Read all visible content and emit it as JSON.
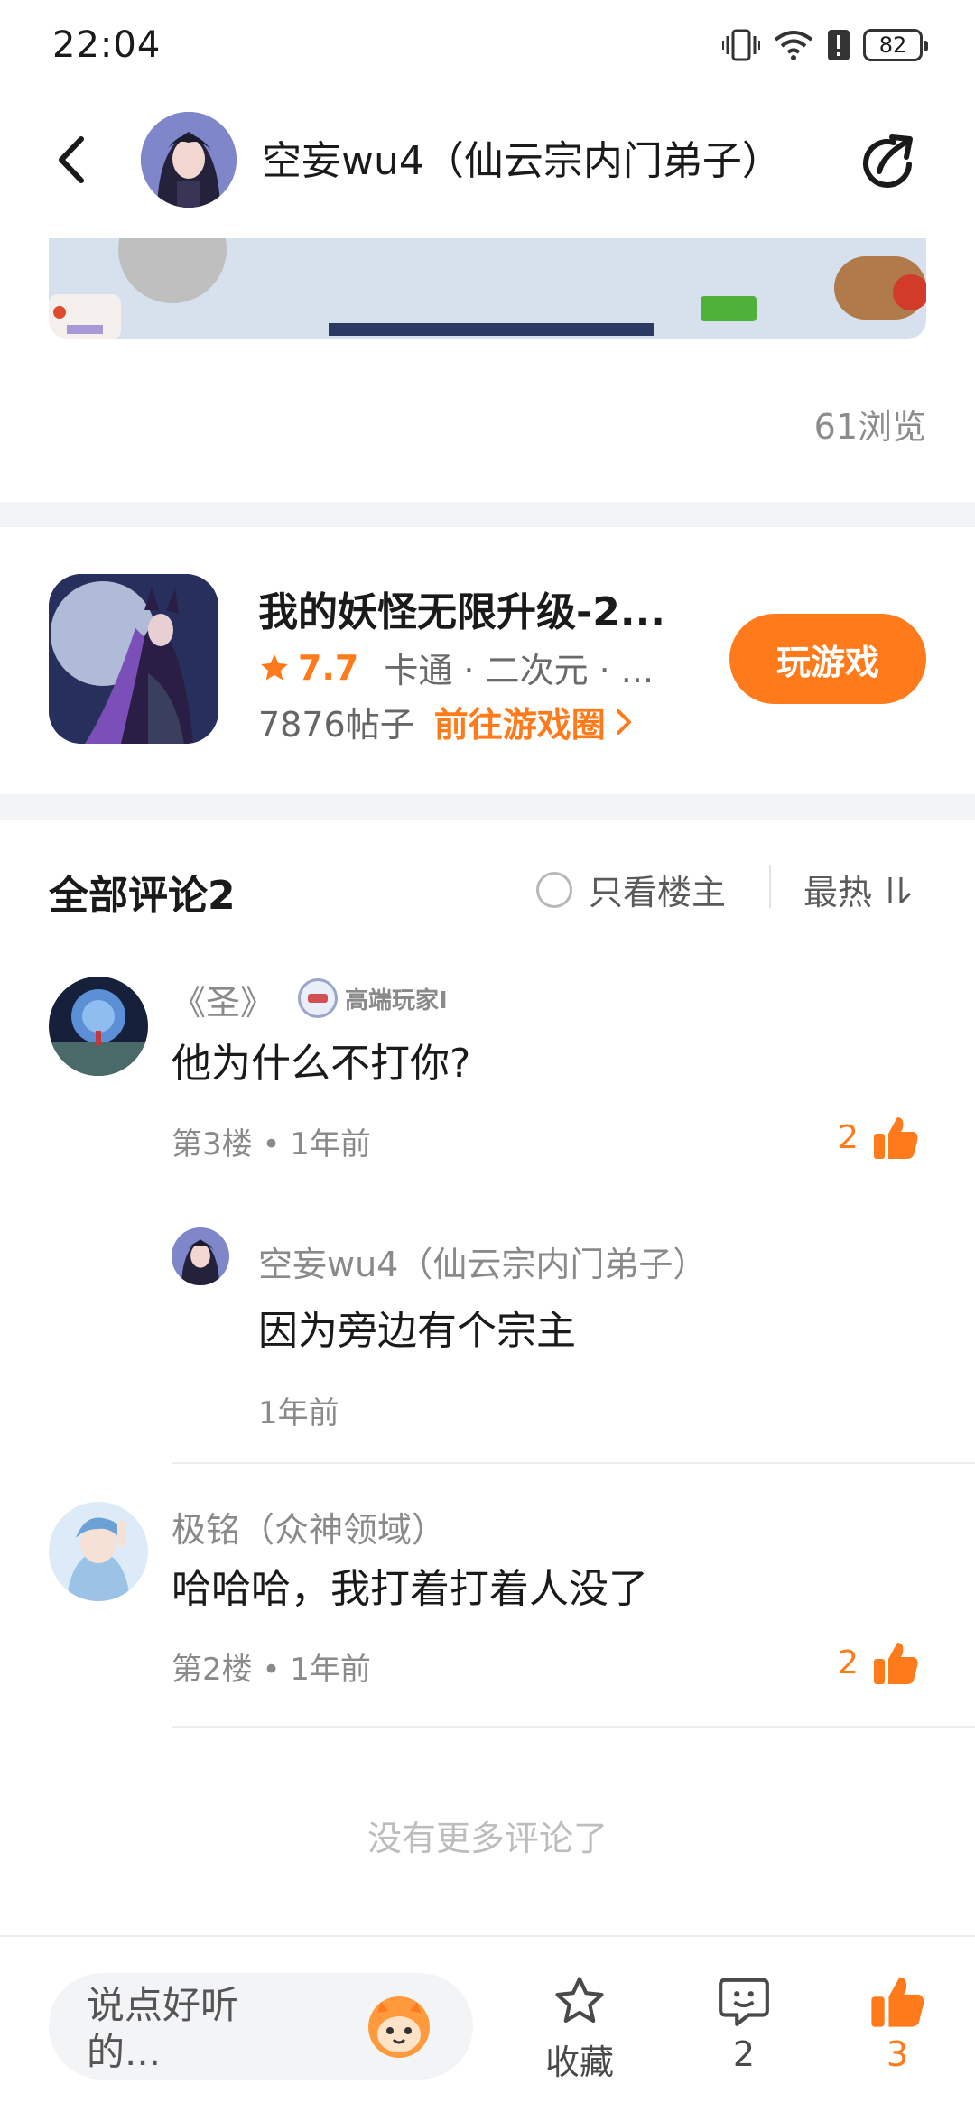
{
  "status_bar": {
    "time": "22:04",
    "battery": "82"
  },
  "header": {
    "title": "空妄wu4（仙云宗内门弟子）"
  },
  "post": {
    "views": "61浏览"
  },
  "game": {
    "title": "我的妖怪无限升级-2...",
    "rating": "7.7",
    "tags": "卡通 · 二次元 · ...",
    "posts": "7876帖子",
    "circle_link": "前往游戏圈",
    "play_button": "玩游戏",
    "colors": {
      "accent": "#ff7a1a"
    }
  },
  "comments_header": {
    "title": "全部评论2",
    "op_only": "只看楼主",
    "sort": "最热"
  },
  "comments": [
    {
      "author": "《圣》",
      "badge": "高端玩家I",
      "text": "他为什么不打你?",
      "meta": "第3楼 • 1年前",
      "likes": "2",
      "replies": [
        {
          "author": "空妄wu4（仙云宗内门弟子）",
          "text": "因为旁边有个宗主",
          "meta": "1年前"
        }
      ]
    },
    {
      "author": "极铭（众神领域）",
      "text": "哈哈哈，我打着打着人没了",
      "meta": "第2楼 • 1年前",
      "likes": "2"
    }
  ],
  "no_more": "没有更多评论了",
  "bottom_bar": {
    "input_placeholder": "说点好听的...",
    "favorite_label": "收藏",
    "comment_count": "2",
    "like_count": "3"
  }
}
